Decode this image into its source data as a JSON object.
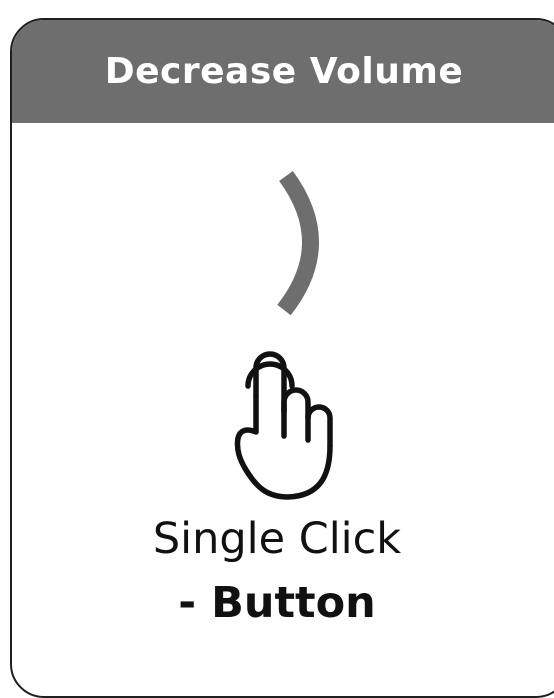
{
  "header": {
    "title": "Decrease Volume"
  },
  "icons": {
    "sound_wave": "volume-wave-icon",
    "hand": "hand-tap-icon"
  },
  "caption": {
    "line1": "Single Click",
    "line2": "- Button"
  },
  "colors": {
    "header_background": "#6e6e6e",
    "header_text": "#ffffff",
    "wave": "#6e6e6e",
    "outline": "#111111"
  }
}
